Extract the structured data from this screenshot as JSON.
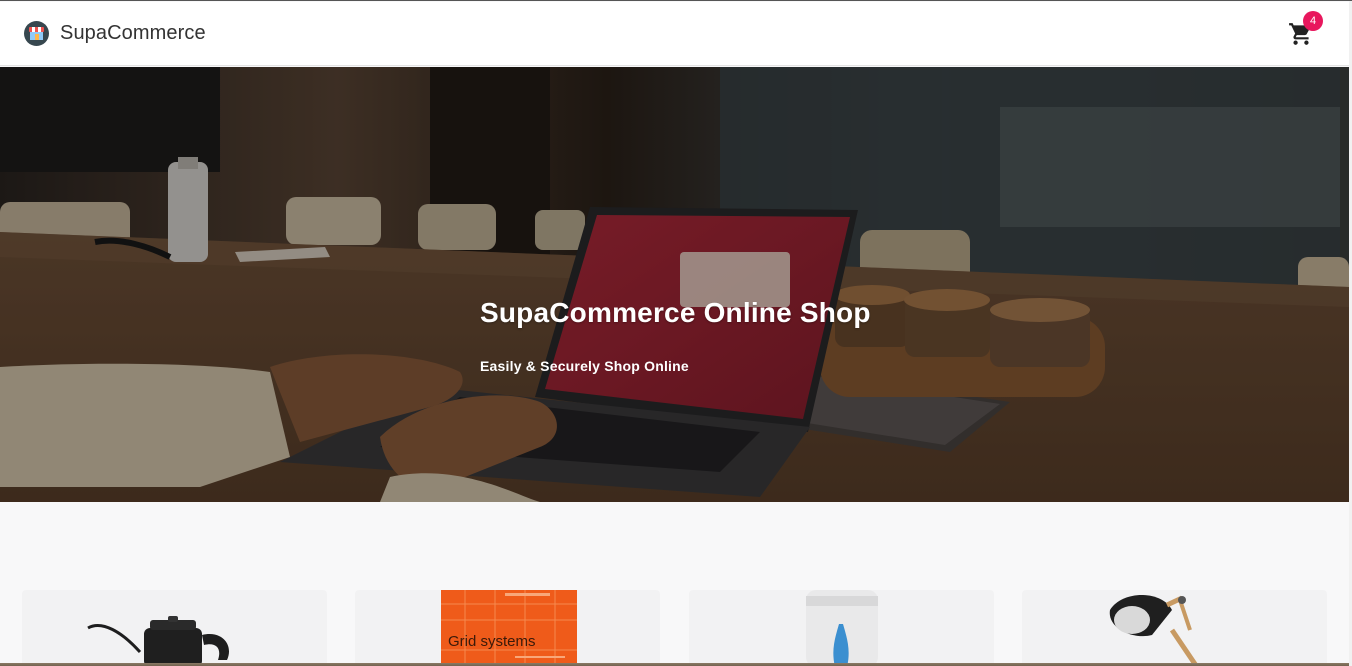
{
  "header": {
    "brand_name": "SupaCommerce",
    "logo_icon": "storefront-icon",
    "cart_icon": "shopping-cart-icon",
    "cart_count": "4",
    "badge_color": "#e8175d"
  },
  "hero": {
    "title": "SupaCommerce Online Shop",
    "subtitle": "Easily & Securely Shop Online",
    "background": "photo of a person typing on a laptop at a wooden conference table"
  },
  "products": [
    {
      "image": "black gooseneck kettle"
    },
    {
      "image": "orange book"
    },
    {
      "image": "white bottle with blue bottle logo"
    },
    {
      "image": "black desk lamp with wooden arm"
    }
  ],
  "product_cover_text": "Grid systems",
  "colors": {
    "header_bg": "#ffffff",
    "page_bg": "#f8f8f9",
    "card_bg": "#f2f2f3"
  }
}
